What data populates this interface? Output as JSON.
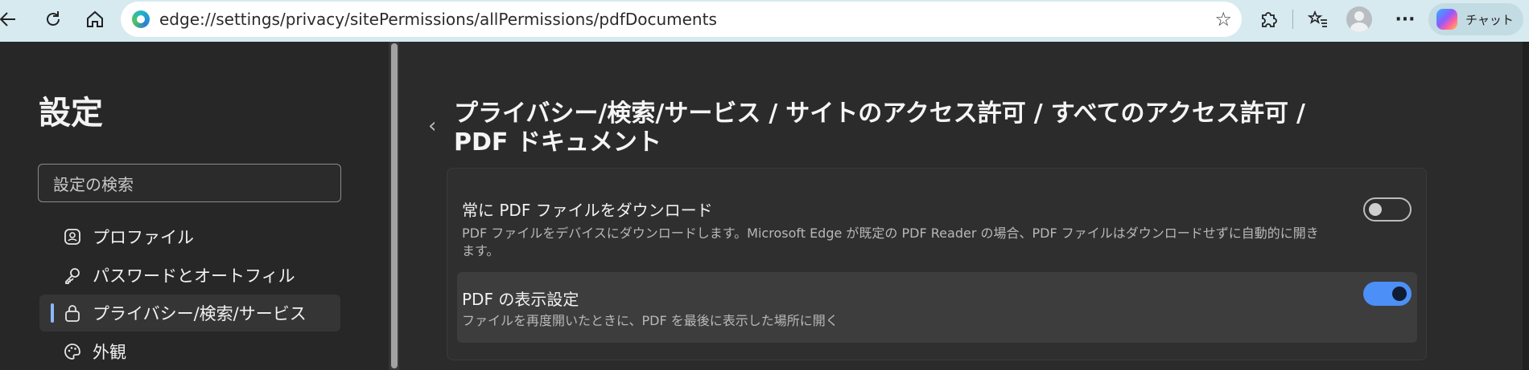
{
  "toolbar": {
    "back_icon": "back-arrow-icon",
    "refresh_icon": "refresh-icon",
    "home_icon": "home-icon",
    "address_url": "edge://settings/privacy/sitePermissions/allPermissions/pdfDocuments",
    "favorite_icon": "star-icon",
    "extensions_icon": "puzzle-icon",
    "favorites_icon": "favorites-list-icon",
    "more_icon": "ellipsis-icon",
    "copilot_label": "チャット"
  },
  "sidebar": {
    "title": "設定",
    "search_placeholder": "設定の検索",
    "items": [
      {
        "label": "プロファイル",
        "icon": "profile-icon",
        "active": false
      },
      {
        "label": "パスワードとオートフィル",
        "icon": "key-icon",
        "active": false
      },
      {
        "label": "プライバシー/検索/サービス",
        "icon": "lock-icon",
        "active": true
      },
      {
        "label": "外観",
        "icon": "palette-icon",
        "active": false
      }
    ]
  },
  "main": {
    "breadcrumb": {
      "items": [
        "プライバシー/検索/サービス",
        "サイトのアクセス許可",
        "すべてのアクセス許可",
        "PDF ドキュメント"
      ],
      "separator": "/"
    },
    "settings": [
      {
        "title": "常に PDF ファイルをダウンロード",
        "description": "PDF ファイルをデバイスにダウンロードします。Microsoft Edge が既定の PDF Reader の場合、PDF ファイルはダウンロードせずに自動的に開きます。",
        "enabled": false
      },
      {
        "title": "PDF の表示設定",
        "description": "ファイルを再度開いたときに、PDF を最後に表示した場所に開く",
        "enabled": true
      }
    ]
  },
  "colors": {
    "toolbar_bg": "#d6eaf0",
    "page_bg": "#2b2b2b",
    "accent": "#4c8ff7"
  }
}
